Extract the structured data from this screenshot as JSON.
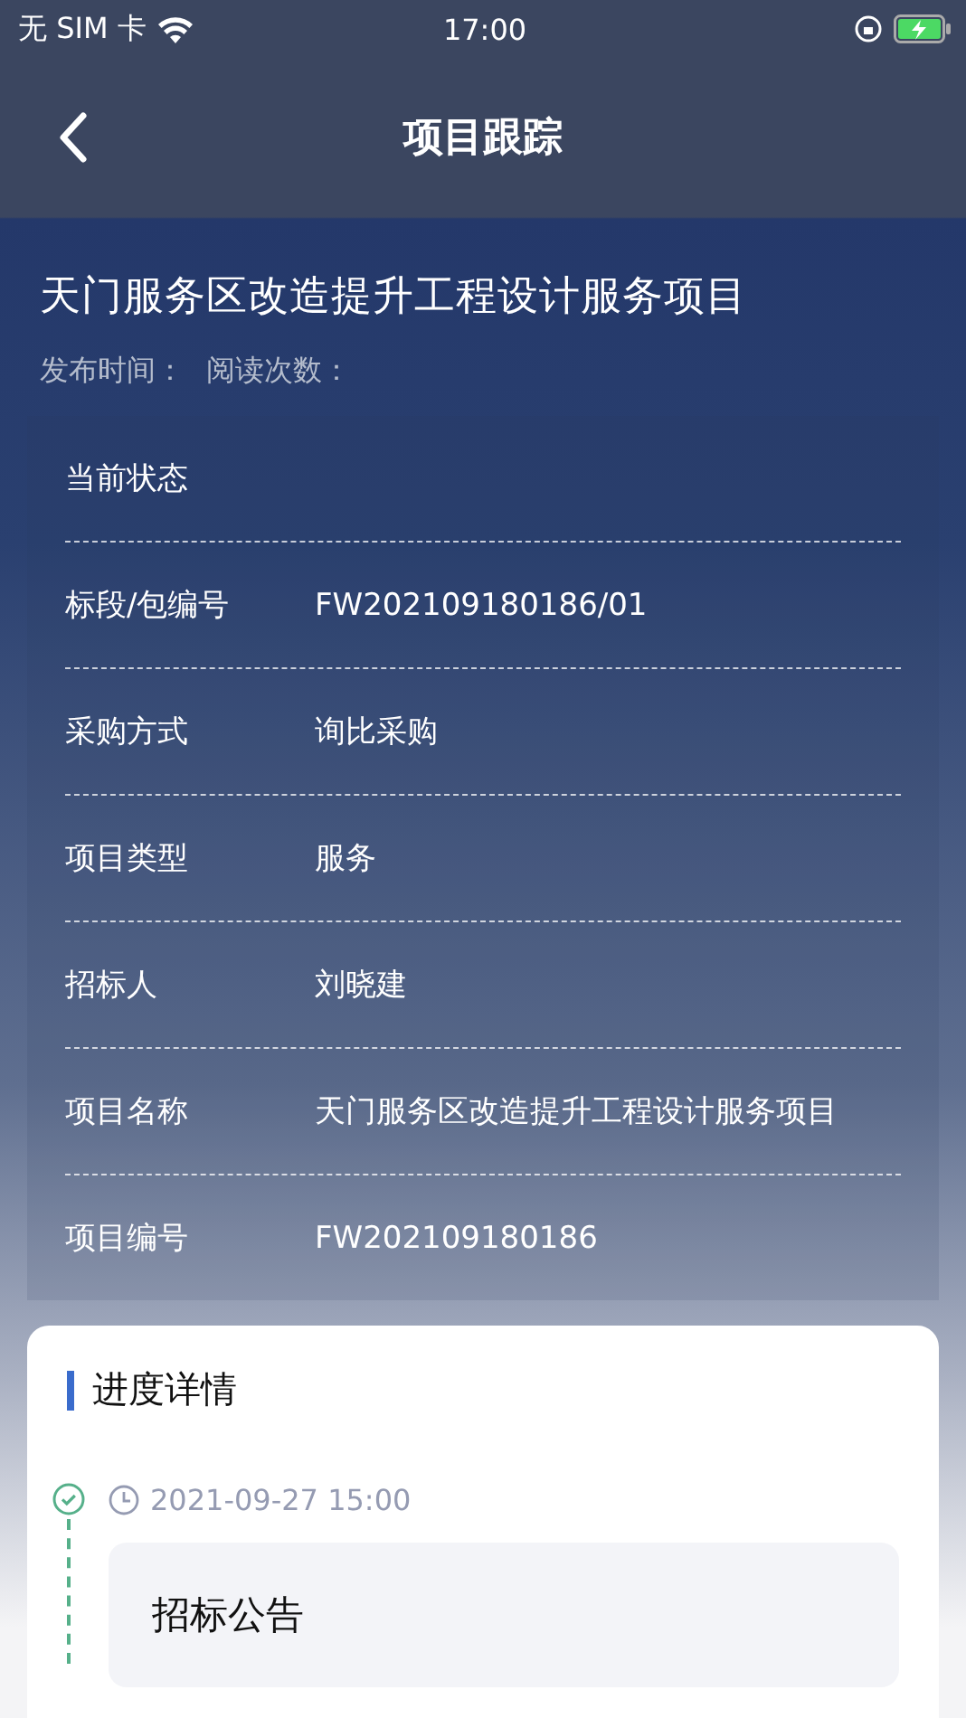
{
  "status_bar": {
    "carrier": "无 SIM 卡",
    "time": "17:00"
  },
  "nav": {
    "title": "项目跟踪"
  },
  "project": {
    "title": "天门服务区改造提升工程设计服务项目",
    "publish_label": "发布时间：",
    "reads_label": "阅读次数："
  },
  "info_rows": [
    {
      "label": "当前状态"
    },
    {
      "label": "标段/包编号",
      "value": "FW202109180186/01"
    },
    {
      "label": "采购方式",
      "value": "询比采购"
    },
    {
      "label": "项目类型",
      "value": "服务"
    },
    {
      "label": "招标人",
      "value": "刘晓建"
    },
    {
      "label": "项目名称",
      "value": "天门服务区改造提升工程设计服务项目"
    },
    {
      "label": "项目编号",
      "value": "FW202109180186"
    }
  ],
  "progress": {
    "title": "进度详情",
    "steps": [
      {
        "time": "2021-09-27 15:00",
        "title": "招标公告",
        "done": true
      }
    ]
  }
}
